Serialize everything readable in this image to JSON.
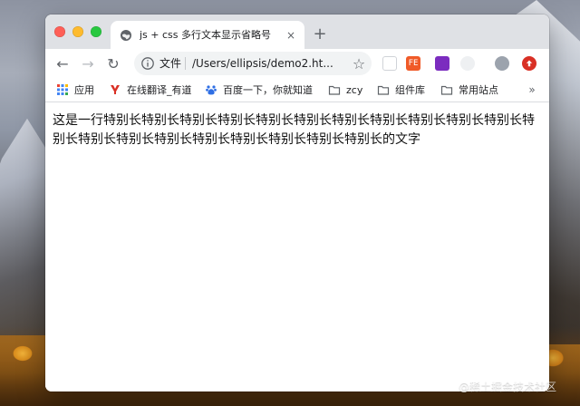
{
  "browser": {
    "tab": {
      "title": "js + css 多行文本显示省略号",
      "close_glyph": "×"
    },
    "new_tab_glyph": "+",
    "toolbar": {
      "back_glyph": "←",
      "forward_glyph": "→",
      "reload_glyph": "↻",
      "omnibox": {
        "site_label": "文件",
        "url": "/Users/ellipsis/demo2.ht..."
      },
      "star_glyph": "☆",
      "extensions": [
        {
          "name": "blank-extension-icon",
          "label": ""
        },
        {
          "name": "fe-extension-icon",
          "label": "FE"
        },
        {
          "name": "purple-extension-icon",
          "label": ""
        },
        {
          "name": "light-extension-icon",
          "label": ""
        },
        {
          "name": "profile-avatar",
          "label": ""
        },
        {
          "name": "update-icon",
          "label": ""
        }
      ]
    },
    "bookmarks": [
      {
        "name": "bookmark-apps",
        "label": "应用",
        "icon": "apps-grid-icon"
      },
      {
        "name": "bookmark-youdao",
        "label": "在线翻译_有道",
        "icon": "youdao-icon"
      },
      {
        "name": "bookmark-baidu",
        "label": "百度一下，你就知道",
        "icon": "baidu-paw-icon"
      },
      {
        "name": "bookmark-zcy",
        "label": "zcy",
        "icon": "folder-icon"
      },
      {
        "name": "bookmark-components",
        "label": "组件库",
        "icon": "folder-icon"
      },
      {
        "name": "bookmark-common-sites",
        "label": "常用站点",
        "icon": "folder-icon"
      }
    ],
    "bookmarks_more_glyph": "»"
  },
  "page": {
    "text": "这是一行特别长特别长特别长特别长特别长特别长特别长特别长特别长特别长特别长特别长特别长特别长特别长特别长特别长特别长特别长特别长的文字"
  },
  "watermark": "@稀土掘金技术社区",
  "colors": {
    "tabstrip": "#dfe1e5",
    "close_red": "#fe5f57",
    "minimize_yellow": "#febb2e",
    "zoom_green": "#28c840"
  }
}
